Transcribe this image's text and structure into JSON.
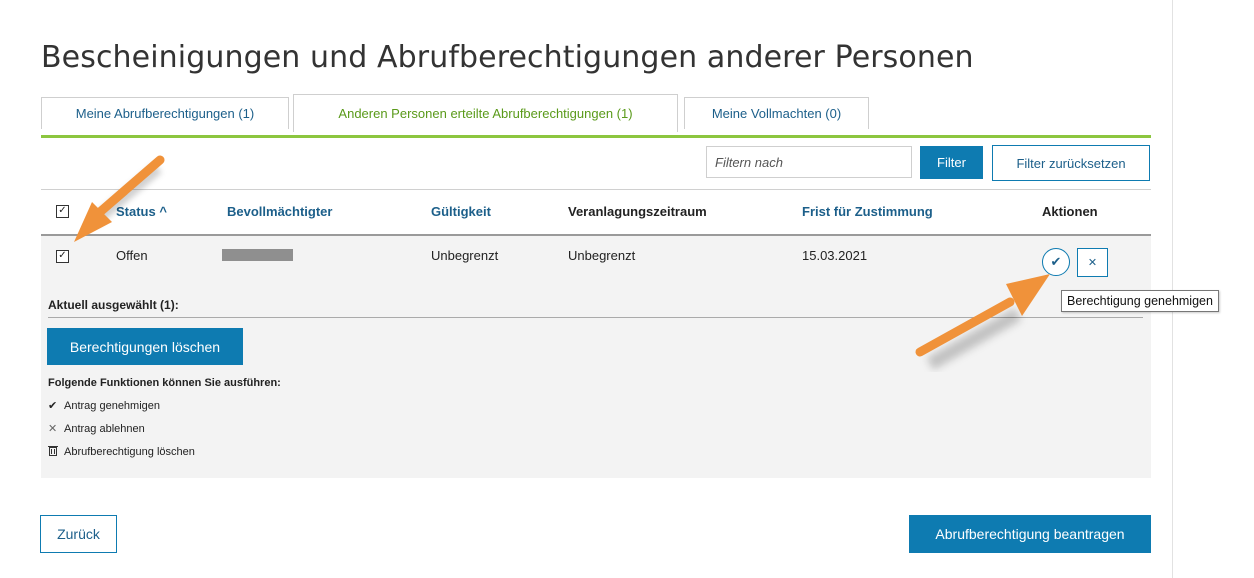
{
  "page": {
    "title": "Bescheinigungen und Abrufberechtigungen anderer Personen"
  },
  "tabs": [
    {
      "label": "Meine Abrufberechtigungen (1)"
    },
    {
      "label": "Anderen Personen erteilte Abrufberechtigungen (1)",
      "active": true
    },
    {
      "label": "Meine Vollmachten (0)"
    }
  ],
  "toolbar": {
    "filter_placeholder": "Filtern nach",
    "filter_label": "Filter",
    "reset_label": "Filter zurücksetzen"
  },
  "table": {
    "columns": [
      "Status ^",
      "Bevollmächtigter",
      "Gültigkeit",
      "Veranlagungszeitraum",
      "Frist für Zustimmung",
      "Aktionen"
    ],
    "rows": [
      {
        "status": "Offen",
        "bevollmaechtigter": "",
        "gueltigkeit": "Unbegrenzt",
        "zeitraum": "Unbegrenzt",
        "frist": "15.03.2021",
        "checked": true
      }
    ],
    "header_checked": true
  },
  "tooltip": {
    "text": "Berechtigung genehmigen"
  },
  "selection": {
    "label": "Aktuell ausgewählt (1):",
    "delete_label": "Berechtigungen löschen",
    "functions_label": "Folgende Funktionen können Sie ausführen:",
    "functions": [
      {
        "icon": "check-icon",
        "label": "Antrag genehmigen"
      },
      {
        "icon": "close-icon",
        "label": "Antrag ablehnen"
      },
      {
        "icon": "trash-icon",
        "label": "Abrufberechtigung löschen"
      }
    ]
  },
  "footer": {
    "back_label": "Zurück",
    "request_label": "Abrufberechtigung beantragen"
  },
  "colors": {
    "primary": "#0e7bb1",
    "link": "#1c5f8a",
    "active_tab": "#5a9a1a",
    "tab_underline": "#8cc63f",
    "annotation_arrow": "#f0923a"
  }
}
